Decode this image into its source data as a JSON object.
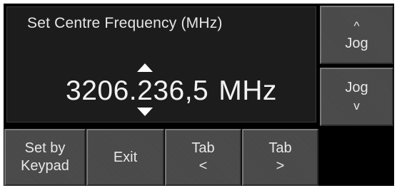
{
  "panel": {
    "title": "Set Centre Frequency (MHz)",
    "frequency": {
      "before_cursor": "3206.",
      "cursor_digit": "2",
      "after_cursor": "36,5",
      "unit": "MHz"
    }
  },
  "side_buttons": {
    "jog_up": {
      "line1": "^",
      "line2": "Jog"
    },
    "jog_down": {
      "line1": "Jog",
      "line2": "v"
    }
  },
  "bottom_buttons": {
    "keypad": {
      "line1": "Set by",
      "line2": "Keypad"
    },
    "exit": {
      "label": "Exit"
    },
    "tab_left": {
      "line1": "Tab",
      "line2": "<"
    },
    "tab_right": {
      "line1": "Tab",
      "line2": ">"
    }
  },
  "colors": {
    "screen_background": "#000000",
    "panel_background": "#1c1c1c",
    "button_face": "#4a4a4a",
    "text": "#e8e8e8"
  }
}
